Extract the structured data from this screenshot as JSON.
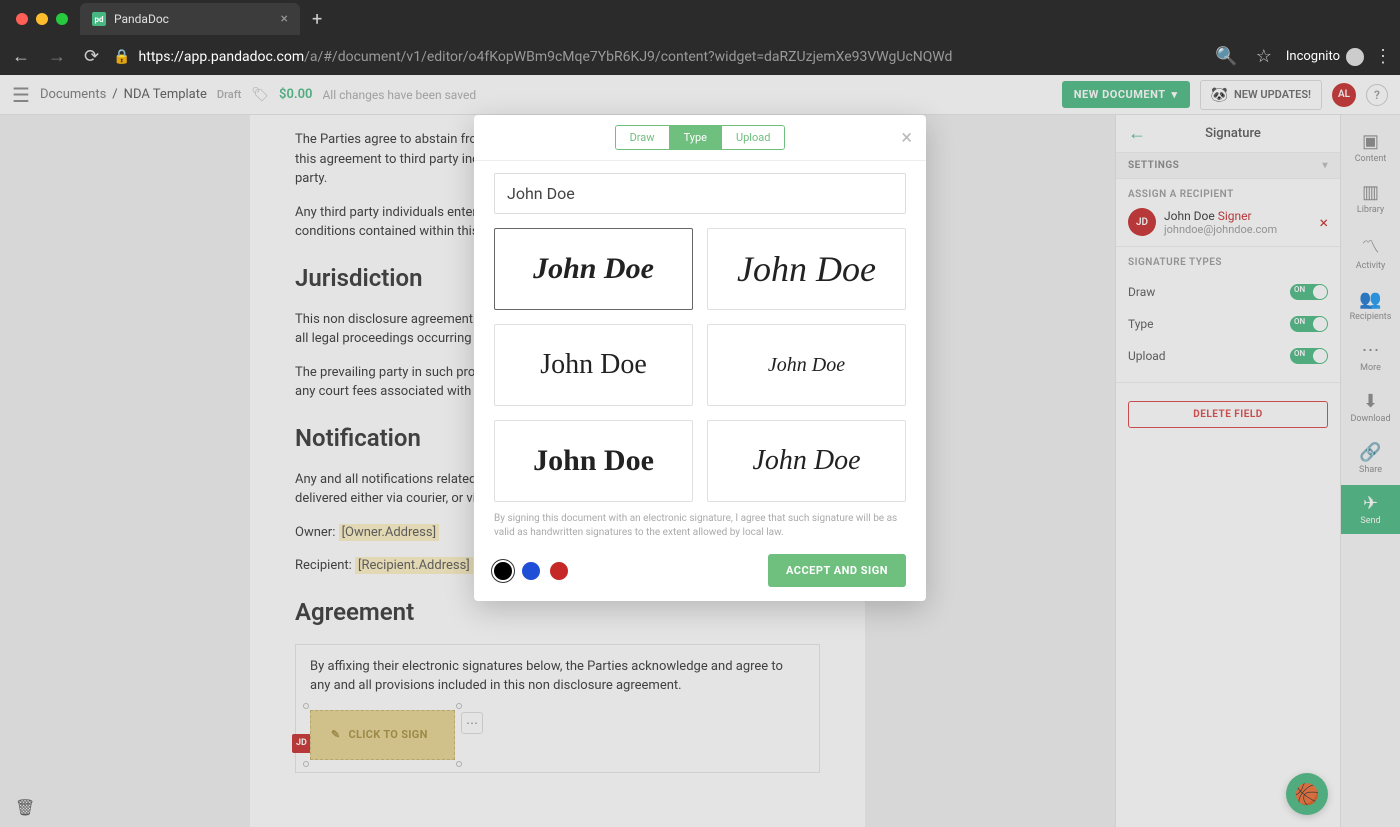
{
  "browser": {
    "tab_title": "PandaDoc",
    "url_prefix": "https://app.pandadoc.com",
    "url_path": "/a/#/document/v1/editor/o4fKopWBm9cMqe7YbR6KJ9/content?widget=daRZUzjemXe93VWgUcNQWd",
    "incognito": "Incognito"
  },
  "header": {
    "breadcrumb_root": "Documents",
    "breadcrumb_sep": "/",
    "breadcrumb_title": "NDA Template",
    "draft_badge": "Draft",
    "price": "$0.00",
    "saved_text": "All changes have been saved",
    "new_doc_btn": "NEW DOCUMENT",
    "new_updates": "NEW UPDATES!",
    "user_initials": "AL"
  },
  "document": {
    "p1": "The Parties agree to abstain from the sale, transferring, or delegating of any provisions of this agreement to third party individuals without the prior written consent of the responding party.",
    "p2": "Any third party individuals entered into this agreement shall be bound by all the terms and conditions contained within this agreement as so.",
    "h2a": "Jurisdiction",
    "p3": "This non disclosure agreement shall fall under the jurisdiction of [Owner.State], furthermore all legal proceedings occurring in relation to this agreement shall be conducted as such.",
    "p4": "The prevailing party in such proceedings shall be permitted to collect all attorney's fees and any court fees associated with said proceedings.",
    "h2b": "Notification",
    "p5": "Any and all notifications related to this non disclosure agreement shall be produced and delivered either via courier, or via certified letter to the addresses listed below.",
    "owner_label": "Owner: ",
    "owner_placeholder": "[Owner.Address]",
    "recipient_label": "Recipient: ",
    "recipient_placeholder": "[Recipient.Address]",
    "h2c": "Agreement",
    "agreement_text": "By affixing their electronic signatures below, the Parties acknowledge and agree to any and all provisions included in this non disclosure agreement.",
    "sign_badge": "JD",
    "sign_btn": "CLICK TO SIGN"
  },
  "side_panel": {
    "title": "Signature",
    "settings": "SETTINGS",
    "assign_label": "ASSIGN A RECIPIENT",
    "recipient": {
      "initials": "JD",
      "name": "John Doe",
      "role": "Signer",
      "email": "johndoe@johndoe.com"
    },
    "sig_types_label": "SIGNATURE TYPES",
    "types": [
      {
        "label": "Draw",
        "on": "ON"
      },
      {
        "label": "Type",
        "on": "ON"
      },
      {
        "label": "Upload",
        "on": "ON"
      }
    ],
    "delete_btn": "DELETE FIELD"
  },
  "rail": {
    "content": "Content",
    "library": "Library",
    "activity": "Activity",
    "recipients": "Recipients",
    "more": "More",
    "download": "Download",
    "share": "Share",
    "send": "Send"
  },
  "modal": {
    "tabs": {
      "draw": "Draw",
      "type": "Type",
      "upload": "Upload"
    },
    "name_value": "John Doe",
    "sig_text": "John Doe",
    "disclaimer": "By signing this document with an electronic signature, I agree that such signature will be as valid as handwritten signatures to the extent allowed by local law.",
    "colors": [
      "#000000",
      "#1f4fd6",
      "#c62828"
    ],
    "accept_btn": "ACCEPT AND SIGN"
  }
}
